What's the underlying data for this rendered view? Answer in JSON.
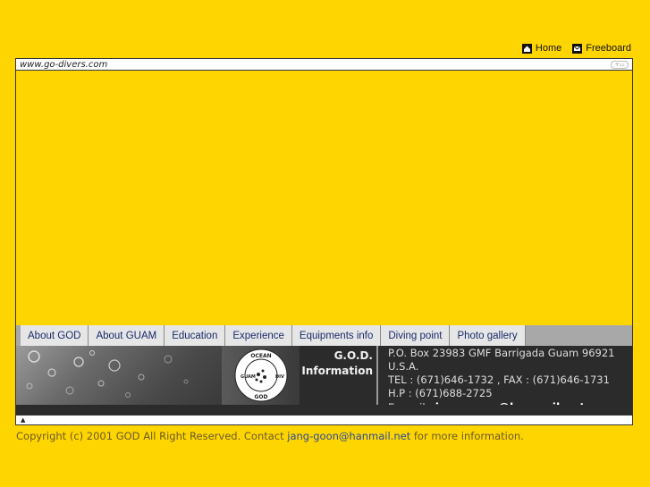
{
  "toplinks": {
    "home_label": "Home",
    "freeboard_label": "Freeboard"
  },
  "urlbar": {
    "url": "www.go-divers.com"
  },
  "nav": {
    "tabs": [
      "About GOD",
      "About GUAM",
      "Education",
      "Experience",
      "Equipments info",
      "Diving point",
      "Photo gallery"
    ]
  },
  "info": {
    "title1": "G.O.D.",
    "title2": "Information",
    "logo_text": "GUAM OCEAN DIVERS GOD",
    "address_line1": "P.O. Box 23983 GMF Barrigada Guam 96921",
    "address_line2": "U.S.A.",
    "tel_line": "TEL   : (671)646-1732 , FAX : (671)646-1731",
    "hp_line": "H.P   : (671)688-2725",
    "email_label": "E=mail : ",
    "email_value": "jang-goon@hanmail.net"
  },
  "footer": {
    "pre": "Copyright (c) 2001 GOD All Right Reserved. Contact ",
    "email": "jang-goon@hanmail.net",
    "post": " for more information."
  },
  "colors": {
    "background": "#FFD500",
    "nav_bg": "#A8A8A8",
    "tab_bg": "#E6E6E6",
    "panel_bg": "#2B2B2B"
  }
}
